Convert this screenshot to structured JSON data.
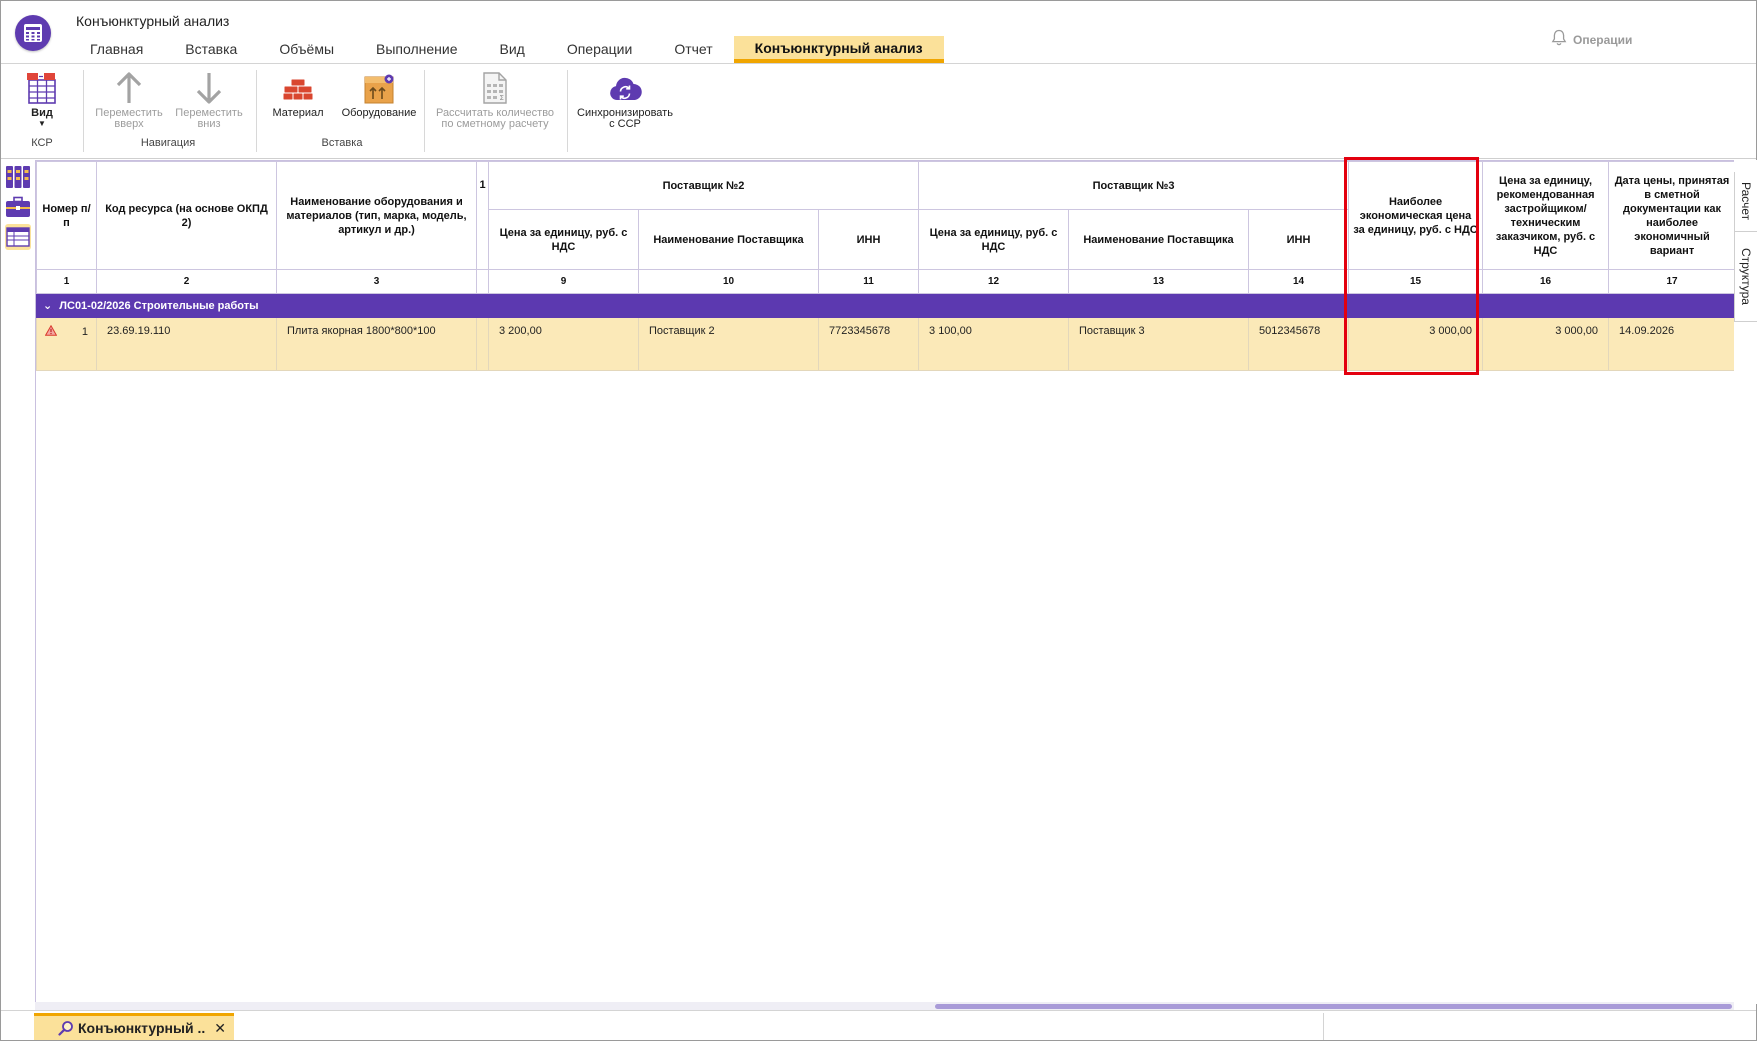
{
  "window": {
    "title": "Конъюнктурный анализ"
  },
  "tabs": [
    {
      "label": "Главная"
    },
    {
      "label": "Вставка"
    },
    {
      "label": "Объёмы"
    },
    {
      "label": "Выполнение"
    },
    {
      "label": "Вид"
    },
    {
      "label": "Операции"
    },
    {
      "label": "Отчет"
    },
    {
      "label": "Конъюнктурный анализ",
      "active": true
    }
  ],
  "header_right": {
    "operations_label": "Операции",
    "icon": "bell-icon"
  },
  "ribbon": {
    "ksr": {
      "group_label": "КСР",
      "view_label": "Вид"
    },
    "navigation": {
      "group_label": "Навигация",
      "move_up": [
        "Переместить",
        "вверх"
      ],
      "move_down": [
        "Переместить",
        "вниз"
      ]
    },
    "insert": {
      "group_label": "Вставка",
      "material_label": "Материал",
      "equipment_label": "Оборудование"
    },
    "calc": {
      "label": [
        "Рассчитать количество",
        "по сметному расчету"
      ]
    },
    "sync": {
      "label": [
        "Синхронизировать",
        "с ССР"
      ]
    }
  },
  "table": {
    "headers": {
      "num": "Номер п/п",
      "code": "Код ресурса (на основе ОКПД 2)",
      "name": "Наименование оборудования и материалов (тип, марка, модель, артикул и др.)",
      "partial": "1",
      "supplier2": "Поставщик №2",
      "supplier3": "Поставщик №3",
      "s2_price": "Цена за единицу, руб. с НДС",
      "s2_name": "Наименование Поставщика",
      "s2_inn": "ИНН",
      "s3_price": "Цена за единицу, руб. с НДС",
      "s3_name": "Наименование Поставщика",
      "s3_inn": "ИНН",
      "best_price": "Наиболее экономическая цена за единицу, руб. с НДС",
      "recommended": "Цена за единицу, рекомендованная застройщиком/ техническим заказчиком, руб. с НДС",
      "date": "Дата цены, принятая в сметной документации как наиболее экономичный вариант"
    },
    "col_numbers": [
      "1",
      "2",
      "3",
      "",
      "9",
      "10",
      "11",
      "12",
      "13",
      "14",
      "15",
      "16",
      "17"
    ],
    "group_label": "ЛС01-02/2026 Строительные работы",
    "rows": [
      {
        "num": "1",
        "code": "23.69.19.110",
        "name": "Плита якорная 1800*800*100",
        "s2_price": "3 200,00",
        "s2_name": "Поставщик 2",
        "s2_inn": "7723345678",
        "s3_price": "3 100,00",
        "s3_name": "Поставщик 3",
        "s3_inn": "5012345678",
        "best_price": "3 000,00",
        "recommended": "3 000,00",
        "date": "14.09.2026"
      }
    ]
  },
  "side_tabs": [
    "Расчет",
    "Структура"
  ],
  "bottom": {
    "doc_tab_label": "Конъюнктурный ..."
  },
  "colors": {
    "accent": "#5c39b0",
    "active_tab": "#fbe19a",
    "active_tab_border": "#f0a500",
    "row_highlight": "#fbe9b8",
    "frame": "#e3000f"
  }
}
